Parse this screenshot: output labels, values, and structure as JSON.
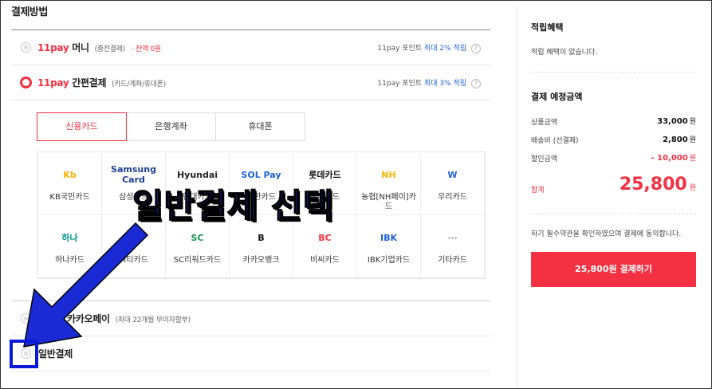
{
  "section_title": "결제방법",
  "methods": [
    {
      "brand": "11pay",
      "label": "머니",
      "sub": "(충전결제)",
      "warn": "· 잔액 0원",
      "point": "11pay 포인트",
      "point_rate": "최대 2% 적립"
    },
    {
      "brand": "11pay",
      "label": "간편결제",
      "sub": "(카드/계좌/휴대폰)",
      "point": "11pay 포인트",
      "point_rate": "최대 3% 적립"
    },
    {
      "label": "카카오페이",
      "sub": "(최대 22개월 무이자할부)"
    },
    {
      "label": "일반결제"
    }
  ],
  "tabs": [
    "신용카드",
    "은행계좌",
    "휴대폰"
  ],
  "cards": [
    {
      "name": "KB국민카드",
      "logo": "Kb",
      "color": "#f7b500"
    },
    {
      "name": "삼성카드",
      "logo": "Samsung Card",
      "color": "#1d3e94"
    },
    {
      "name": "현대카드",
      "logo": "Hyundai",
      "color": "#222222"
    },
    {
      "name": "신한카드",
      "logo": "SOL Pay",
      "color": "#1e62d9"
    },
    {
      "name": "롯데카드",
      "logo": "롯데카드",
      "color": "#111111"
    },
    {
      "name": "농협[NH페이]카드",
      "logo": "NH",
      "color": "#f7b500"
    },
    {
      "name": "우리카드",
      "logo": "W",
      "color": "#1e62d9"
    },
    {
      "name": "하나카드",
      "logo": "하나",
      "color": "#009490"
    },
    {
      "name": "씨티카드",
      "logo": "citi",
      "color": "#f43142"
    },
    {
      "name": "SC리워드카드",
      "logo": "SC",
      "color": "#1a8f4f"
    },
    {
      "name": "카카오뱅크",
      "logo": "B",
      "color": "#111111"
    },
    {
      "name": "비씨카드",
      "logo": "BC",
      "color": "#f43142"
    },
    {
      "name": "IBK기업카드",
      "logo": "IBK",
      "color": "#1e62d9"
    },
    {
      "name": "기타카드",
      "logo": "···",
      "color": "#999999"
    }
  ],
  "sidebar": {
    "reward_title": "적립혜택",
    "reward_text": "적립 혜택이 없습니다.",
    "amount_title": "결제 예정금액",
    "rows": [
      {
        "label": "상품금액",
        "value": "33,000",
        "unit": "원"
      },
      {
        "label": "배송비 (선결제)",
        "value": "2,800",
        "unit": "원"
      },
      {
        "label": "할인금액",
        "value": "- 10,000",
        "unit": "원"
      }
    ],
    "total_label": "합계",
    "total_value": "25,800",
    "total_unit": "원",
    "agree_text": "하기 필수약관을 확인하였으며 결제에 동의합니다.",
    "pay_button": "25,800원 결제하기"
  },
  "overlay": {
    "caption": "일반결제 선택",
    "color": "#1a2bd6"
  }
}
